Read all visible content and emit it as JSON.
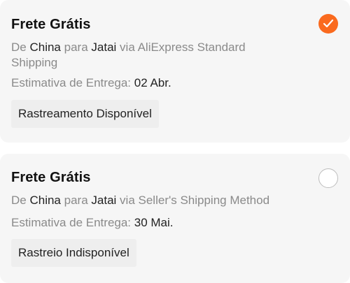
{
  "colors": {
    "accent": "#fa6a1e",
    "card_bg": "#f6f6f6",
    "muted_text": "#8a8a8a"
  },
  "options": [
    {
      "title": "Frete Grátis",
      "route_from_prefix": "De",
      "origin": "China",
      "route_to_prefix": "para",
      "destination": "Jatai",
      "via_prefix": "via",
      "method": "AliExpress Standard Shipping",
      "eta_label": "Estimativa de Entrega:",
      "eta_date": "02 Abr.",
      "tracking": "Rastreamento Disponível",
      "selected": true,
      "radio_icon": "check-icon"
    },
    {
      "title": "Frete Grátis",
      "route_from_prefix": "De",
      "origin": "China",
      "route_to_prefix": "para",
      "destination": "Jatai",
      "via_prefix": "via",
      "method": "Seller's Shipping Method",
      "eta_label": "Estimativa de Entrega:",
      "eta_date": "30 Mai.",
      "tracking": "Rastreio Indisponível",
      "selected": false,
      "radio_icon": "radio-unchecked-icon"
    }
  ]
}
